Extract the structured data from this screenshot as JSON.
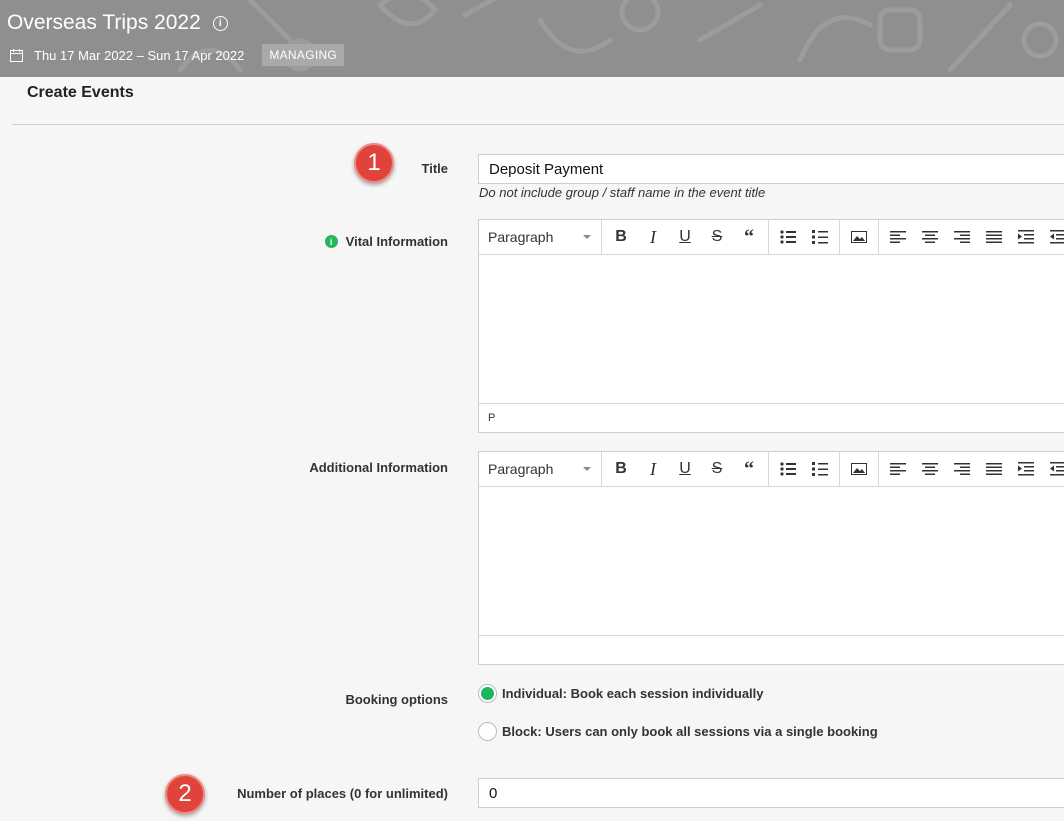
{
  "header": {
    "title": "Overseas Trips 2022",
    "dates": "Thu 17 Mar 2022 – Sun 17 Apr 2022",
    "badge": "MANAGING"
  },
  "section_title": "Create Events",
  "steps": [
    "1",
    "2"
  ],
  "form": {
    "title": {
      "label": "Title",
      "value": "Deposit Payment",
      "hint": "Do not include group / staff name in the event title"
    },
    "vital": {
      "label": "Vital Information",
      "format": "Paragraph",
      "status": "P"
    },
    "additional": {
      "label": "Additional Information",
      "format": "Paragraph"
    },
    "booking": {
      "label": "Booking options",
      "options": [
        {
          "label": "Individual: Book each session individually",
          "checked": true
        },
        {
          "label": "Block: Users can only book all sessions via a single booking",
          "checked": false
        }
      ]
    },
    "places": {
      "label": "Number of places (0 for unlimited)",
      "value": "0"
    }
  },
  "toolbar_icons": [
    "bold-icon",
    "italic-icon",
    "underline-icon",
    "strikethrough-icon",
    "blockquote-icon",
    "bullet-list-icon",
    "numbered-list-icon",
    "image-icon",
    "align-left-icon",
    "align-center-icon",
    "align-right-icon",
    "align-justify-icon",
    "indent-icon",
    "outdent-icon"
  ],
  "colors": {
    "banner": "#8f8f8f",
    "step": "#e0433b",
    "radio_checked": "#1fb55c"
  }
}
